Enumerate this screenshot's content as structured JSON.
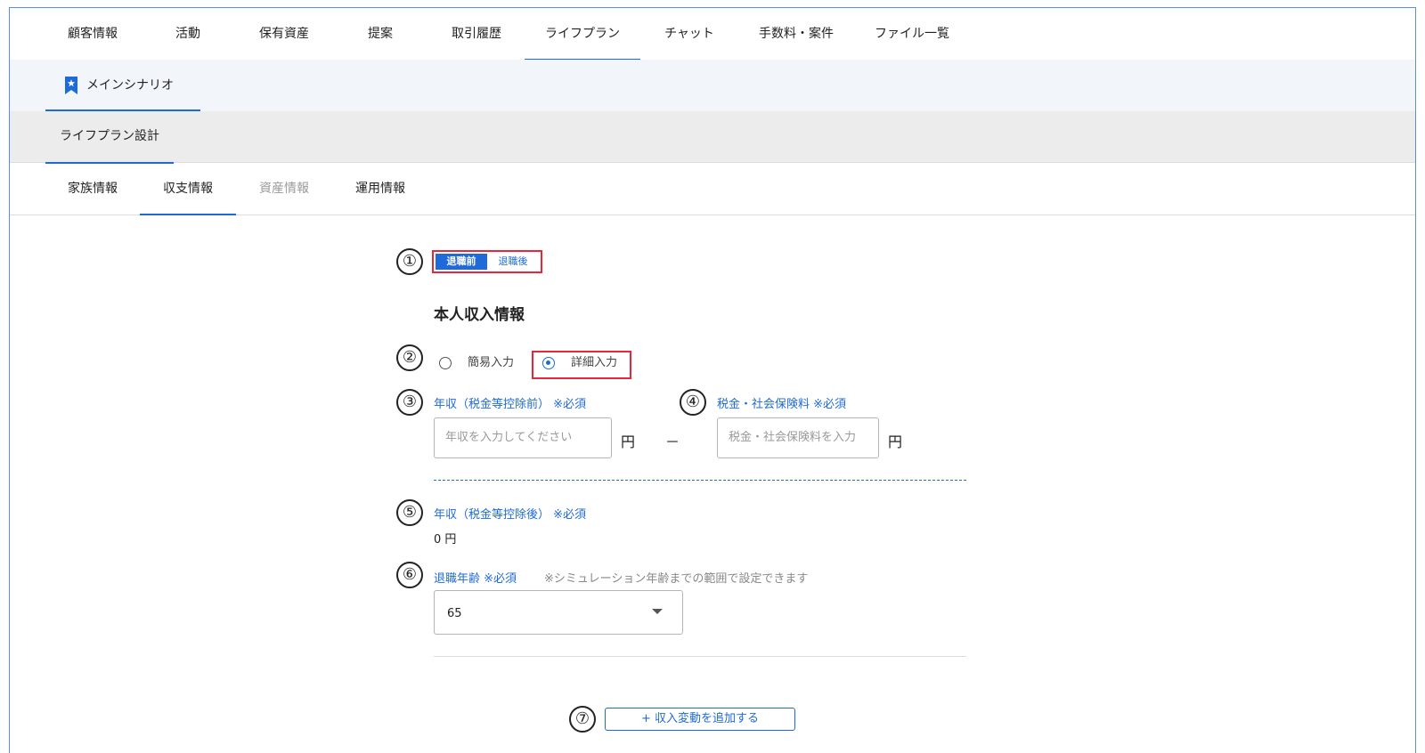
{
  "top_nav": {
    "tabs": [
      {
        "label": "顧客情報"
      },
      {
        "label": "活動"
      },
      {
        "label": "保有資産"
      },
      {
        "label": "提案"
      },
      {
        "label": "取引履歴"
      },
      {
        "label": "ライフプラン",
        "active": true
      },
      {
        "label": "チャット"
      },
      {
        "label": "手数料・案件"
      },
      {
        "label": "ファイル一覧"
      }
    ]
  },
  "scenario": {
    "label": "メインシナリオ",
    "icon": "bookmark-star-icon"
  },
  "design": {
    "label": "ライフプラン設計"
  },
  "sub_nav": {
    "tabs": [
      {
        "label": "家族情報"
      },
      {
        "label": "収支情報",
        "active": true
      },
      {
        "label": "資産情報",
        "disabled": true
      },
      {
        "label": "運用情報"
      }
    ]
  },
  "markers": [
    "①",
    "②",
    "③",
    "④",
    "⑤",
    "⑥",
    "⑦"
  ],
  "retirement_toggle": {
    "before": "退職前",
    "after": "退職後",
    "selected": "退職前"
  },
  "section_title": "本人収入情報",
  "input_mode": {
    "simple": "簡易入力",
    "detail": "詳細入力",
    "selected": "詳細入力"
  },
  "income_before_tax": {
    "label": "年収（税金等控除前）",
    "required": "※必須",
    "placeholder": "年収を入力してください",
    "unit": "円"
  },
  "minus": "－",
  "tax_insurance": {
    "label": "税金・社会保険料",
    "required": "※必須",
    "placeholder": "税金・社会保険料を入力",
    "unit": "円"
  },
  "income_after_tax": {
    "label": "年収（税金等控除後）",
    "required": "※必須",
    "value": "0 円"
  },
  "retirement_age": {
    "label": "退職年齢",
    "required": "※必須",
    "hint": "※シミュレーション年齢までの範囲で設定できます",
    "value": "65"
  },
  "add_button": {
    "label": "+ 収入変動を追加する"
  },
  "colors": {
    "accent": "#1e6ad8",
    "highlight": "#e8283a"
  }
}
